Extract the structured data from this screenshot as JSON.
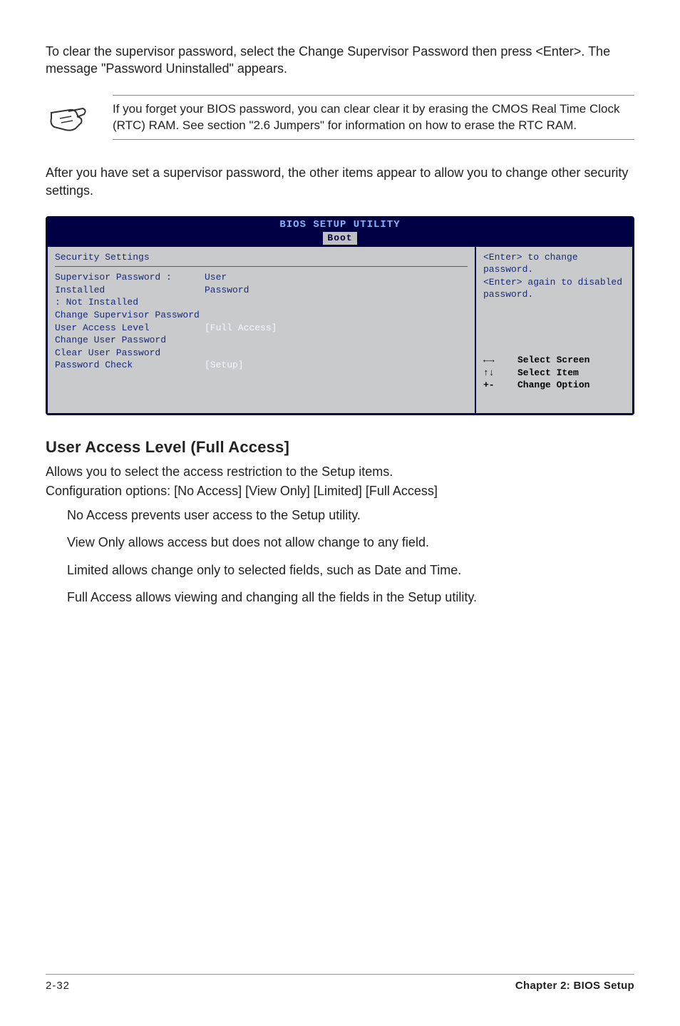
{
  "intro1": "To clear the supervisor password, select the Change Supervisor Password then press <Enter>. The message \"Password Uninstalled\" appears.",
  "note": "If you forget your BIOS password, you can clear clear it by erasing the CMOS Real Time Clock (RTC) RAM. See section \"2.6  Jumpers\" for information on how to erase the RTC RAM.",
  "intro2": "After you have set a supervisor password, the other items appear to allow you to change other security settings.",
  "bios": {
    "title": "BIOS SETUP UTILITY",
    "tab": "Boot",
    "left": {
      "heading": "Security Settings",
      "sup_label": "Supervisor Password",
      "sup_sep": " : ",
      "sup_val": "Installed",
      "user_label": "User Password",
      "user_sep": " : ",
      "user_val": "Not Installed",
      "item1": "Change Supervisor Password",
      "item2": "User Access Level",
      "item2_val": "[Full Access]",
      "item3": "Change User Password",
      "item4": "Clear User Password",
      "item5": "Password Check",
      "item5_val": "[Setup]"
    },
    "right": {
      "help1": "<Enter> to change password.",
      "help2": "<Enter> again to disabled password.",
      "legend": [
        {
          "key": "←→",
          "txt": "Select Screen"
        },
        {
          "key": "↑↓",
          "txt": "Select Item"
        },
        {
          "key": "+-",
          "txt": "Change Option"
        }
      ]
    }
  },
  "section_heading": "User Access Level (Full Access]",
  "section_desc": "Allows you to select the access restriction to the Setup items.",
  "section_opts": "Configuration options: [No Access] [View Only] [Limited] [Full Access]",
  "options": [
    "No Access prevents user access to the Setup utility.",
    "View Only allows access but does not allow change to any field.",
    "Limited allows change only to selected fields, such as Date and Time.",
    "Full Access allows viewing and changing all the fields in the Setup utility."
  ],
  "footer": {
    "page": "2-32",
    "chapter": "Chapter 2: BIOS Setup"
  }
}
